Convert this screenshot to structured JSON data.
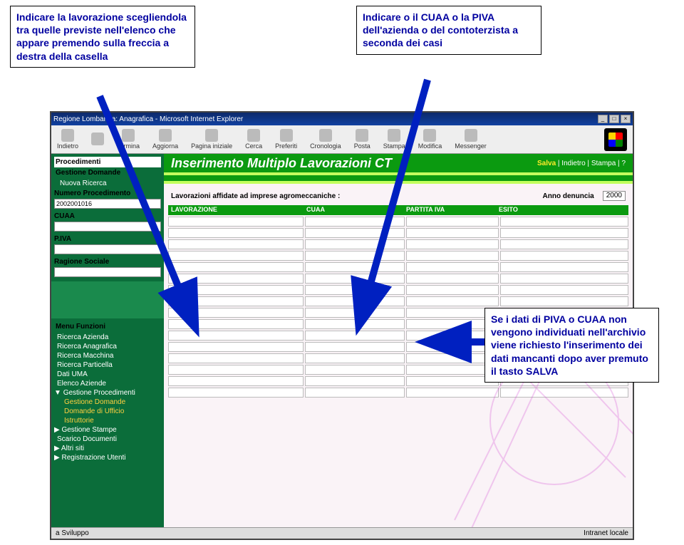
{
  "callouts": {
    "left": "Indicare la lavorazione scegliendola tra quelle previste nell'elenco che appare premendo sulla freccia a destra della casella",
    "right": "Indicare o il CUAA o la PIVA dell'azienda o del contoterzista a seconda dei casi",
    "result": "Se i dati di PIVA o CUAA non vengono individuati nell'archivio viene richiesto l'inserimento dei dati mancanti dopo aver premuto il tasto SALVA"
  },
  "browser": {
    "title": "Regione Lombardia: Anagrafica - Microsoft Internet Explorer",
    "toolbar": [
      "Indietro",
      "",
      "Termina",
      "Aggiorna",
      "Pagina iniziale",
      "Cerca",
      "Preferiti",
      "Cronologia",
      "Posta",
      "Stampa",
      "Modifica",
      "Messenger"
    ],
    "status_left": "a Sviluppo",
    "status_right": "Intranet locale"
  },
  "sidebar": {
    "procedimenti": "Procedimenti",
    "gestione": "Gestione Domande",
    "nuova": "Nuova Ricerca",
    "numero": "Numero Procedimento",
    "numero_val": "2002001016",
    "cuaa": "CUAA",
    "piva": "P.IVA",
    "ragione": "Ragione Sociale",
    "menu": "Menu Funzioni",
    "items": [
      "Ricerca Azienda",
      "Ricerca Anagrafica",
      "Ricerca Macchina",
      "Ricerca Particella",
      "Dati UMA",
      "Elenco Aziende"
    ],
    "gp": "Gestione Procedimenti",
    "gp_sub": [
      "Gestione Domande",
      "Domande di Ufficio",
      "Istruttorie"
    ],
    "tail": [
      "Gestione Stampe",
      "Scarico Documenti",
      "Altri siti",
      "Registrazione Utenti"
    ]
  },
  "main": {
    "title": "Inserimento Multiplo Lavorazioni CT",
    "links": {
      "salva": "Salva",
      "indietro": "Indietro",
      "stampa": "Stampa",
      "help": "?"
    },
    "info_label": "Lavorazioni affidate ad imprese agromeccaniche :",
    "anno_label": "Anno denuncia",
    "anno_val": "2000",
    "cols": [
      "LAVORAZIONE",
      "CUAA",
      "PARTITA IVA",
      "ESITO"
    ]
  }
}
